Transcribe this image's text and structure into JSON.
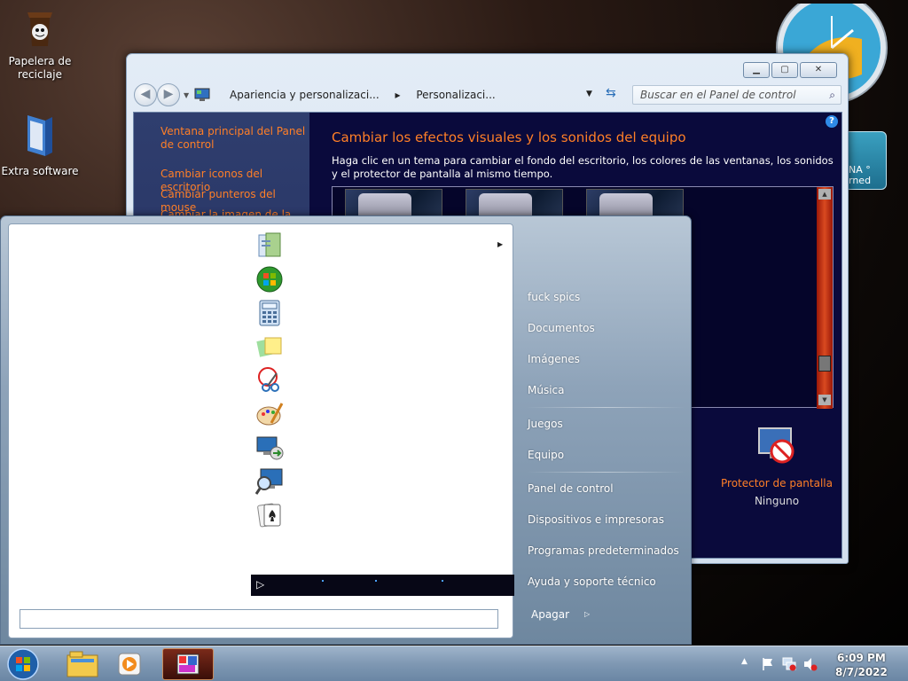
{
  "desktop": {
    "icons": [
      {
        "label": "Papelera de reciclaje"
      },
      {
        "label": "Extra software"
      }
    ]
  },
  "weather_gadget": {
    "line1": "NA °",
    "line2": "rned"
  },
  "control_panel": {
    "breadcrumb": [
      "Apariencia y personalizaci...",
      "Personalizaci..."
    ],
    "search_placeholder": "Buscar en el Panel de control",
    "sidebar": {
      "links": [
        "Ventana principal del Panel de control",
        "Cambiar iconos del escritorio",
        "Cambiar punteros del mouse",
        "Cambiar la imagen de la"
      ]
    },
    "main": {
      "title": "Cambiar los efectos visuales y los sonidos del equipo",
      "description": "Haga clic en un tema para cambiar el fondo del escritorio, los colores de las ventanas, los sonidos y el protector de pantalla al mismo tiempo."
    },
    "screensaver": {
      "title": "Protector de pantalla",
      "value": "Ninguno"
    }
  },
  "start_menu": {
    "programs": [
      {
        "icon": "getting-started-icon"
      },
      {
        "icon": "windows-media-center-icon"
      },
      {
        "icon": "calculator-icon"
      },
      {
        "icon": "sticky-notes-icon"
      },
      {
        "icon": "snipping-tool-icon"
      },
      {
        "icon": "paint-icon"
      },
      {
        "icon": "remote-desktop-icon"
      },
      {
        "icon": "magnifier-icon"
      },
      {
        "icon": "solitaire-icon"
      }
    ],
    "right_items": [
      "fuck spics",
      "Documentos",
      "Imágenes",
      "Música",
      "Juegos",
      "Equipo",
      "Panel de control",
      "Dispositivos e impresoras",
      "Programas predeterminados",
      "Ayuda y soporte técnico"
    ],
    "shutdown_label": "Apagar"
  },
  "taskbar": {
    "time": "6:09 PM",
    "date": "8/7/2022"
  }
}
